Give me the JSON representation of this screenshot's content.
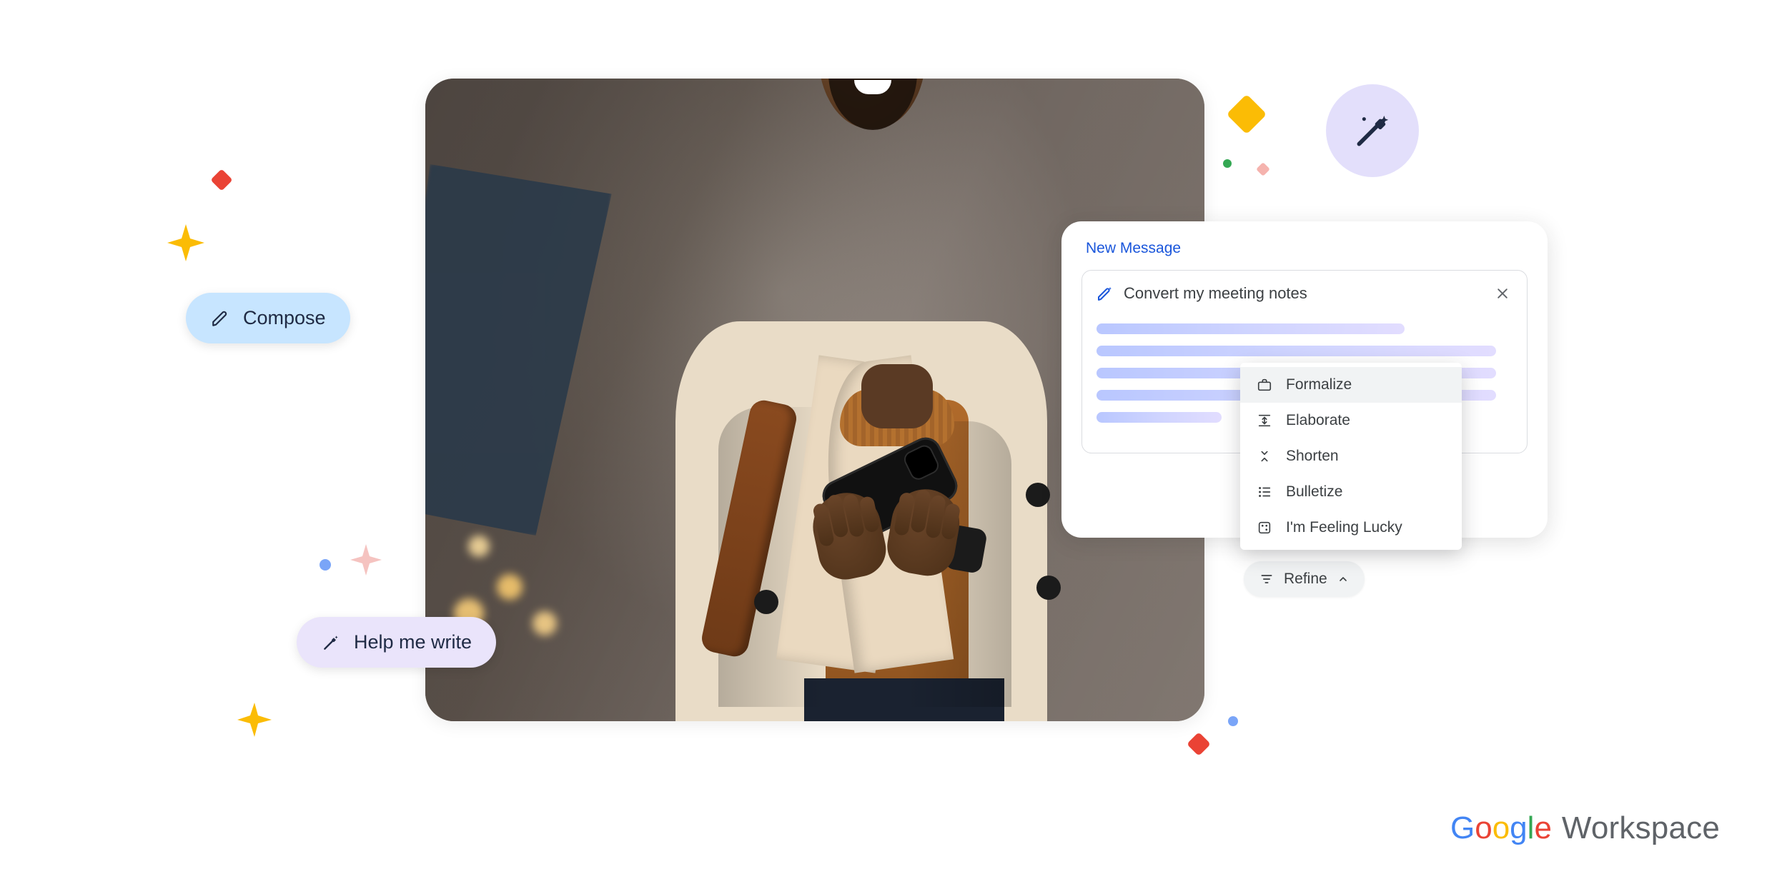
{
  "chips": {
    "compose": "Compose",
    "help_me_write": "Help me write"
  },
  "panel": {
    "title": "New Message",
    "prompt": "Convert my meeting notes"
  },
  "menu": {
    "items": [
      {
        "id": "formalize",
        "label": "Formalize"
      },
      {
        "id": "elaborate",
        "label": "Elaborate"
      },
      {
        "id": "shorten",
        "label": "Shorten"
      },
      {
        "id": "bulletize",
        "label": "Bulletize"
      },
      {
        "id": "lucky",
        "label": "I'm Feeling Lucky"
      }
    ]
  },
  "refine_label": "Refine",
  "brand": {
    "google": "Google",
    "workspace": "Workspace"
  },
  "colors": {
    "blue": "#4285F4",
    "red": "#EA4335",
    "yellow": "#FBBC05",
    "green": "#34A853",
    "lavender": "#E3DFFB",
    "chip_blue": "#C7E5FF",
    "chip_lav": "#EAE4FB"
  }
}
